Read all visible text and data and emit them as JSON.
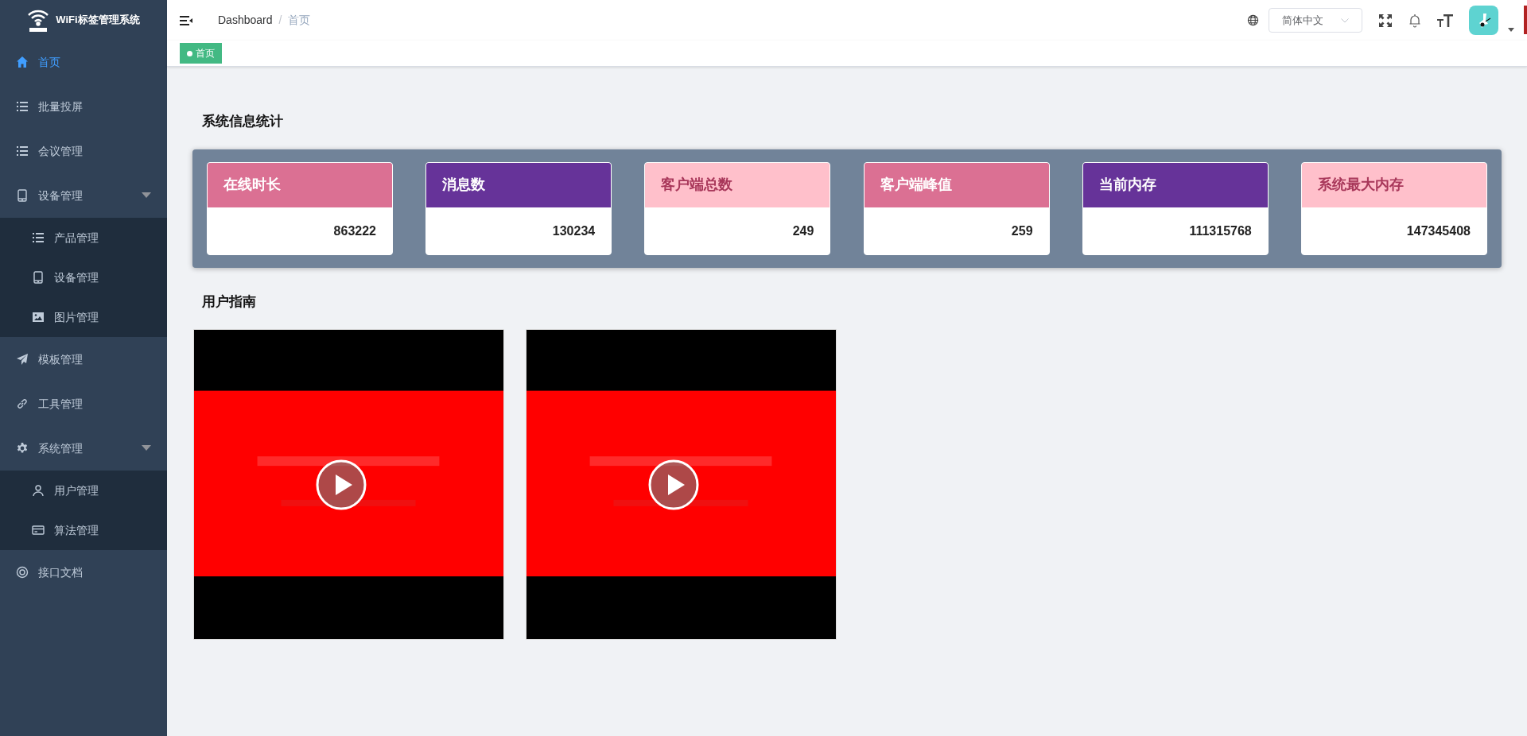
{
  "sidebar": {
    "logo_title": "WiFi标签管理系统",
    "items": [
      {
        "label": "首页",
        "selected": true
      },
      {
        "label": "批量投屏",
        "selected": false
      },
      {
        "label": "会议管理",
        "selected": false
      },
      {
        "label": "设备管理",
        "selected": false,
        "expanded": true,
        "children": [
          {
            "label": "产品管理",
            "selected": false
          },
          {
            "label": "设备管理",
            "selected": false
          },
          {
            "label": "图片管理",
            "selected": false
          }
        ]
      },
      {
        "label": "模板管理",
        "selected": false
      },
      {
        "label": "工具管理",
        "selected": false
      },
      {
        "label": "系统管理",
        "selected": false,
        "expanded": true,
        "children": [
          {
            "label": "用户管理",
            "selected": false
          },
          {
            "label": "算法管理",
            "selected": false
          }
        ]
      },
      {
        "label": "接口文档",
        "selected": false
      }
    ]
  },
  "header": {
    "breadcrumb": [
      "Dashboard",
      "首页"
    ],
    "breadcrumb_separator": "/",
    "language": "简体中文"
  },
  "tags": [
    {
      "label": "首页",
      "selected": true
    }
  ],
  "stats": {
    "title": "系统信息统计",
    "cards": [
      {
        "label": "在线时长",
        "value": "863222",
        "color": "#db7093"
      },
      {
        "label": "消息数",
        "value": "130234",
        "color": "#663399"
      },
      {
        "label": "客户端总数",
        "value": "249",
        "color": "#ffc0cb"
      },
      {
        "label": "客户端峰值",
        "value": "259",
        "color": "#db7093"
      },
      {
        "label": "当前内存",
        "value": "111315768",
        "color": "#663399"
      },
      {
        "label": "系统最大内存",
        "value": "147345408",
        "color": "#ffc0cb"
      }
    ]
  },
  "guide": {
    "title": "用户指南"
  }
}
